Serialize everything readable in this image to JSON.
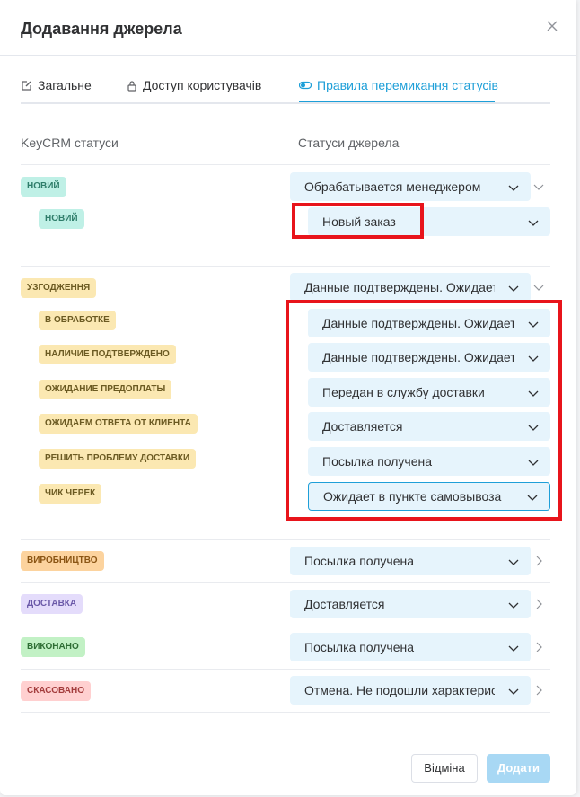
{
  "modal": {
    "title": "Додавання джерела"
  },
  "tabs": [
    {
      "label": "Загальне",
      "icon": "edit-icon"
    },
    {
      "label": "Доступ користувачів",
      "icon": "lock-icon"
    },
    {
      "label": "Правила перемикання статусів",
      "icon": "toggle-icon",
      "active": true
    }
  ],
  "columns": {
    "left": "KeyCRM статуси",
    "right": "Статуси джерела"
  },
  "groups": [
    {
      "status": "НОВИЙ",
      "color": "teal",
      "source": "Обрабатывается менеджером",
      "expanded": true,
      "children": [
        {
          "status": "НОВИЙ",
          "source": "Новый заказ"
        }
      ]
    },
    {
      "status": "УЗГОДЖЕННЯ",
      "color": "yellow",
      "source": "Данные подтверждены. Ожидает отп",
      "expanded": true,
      "children": [
        {
          "status": "В ОБРАБОТКЕ",
          "source": "Данные подтверждены. Ожидает отп"
        },
        {
          "status": "НАЛИЧИЕ ПОДТВЕРЖДЕНО",
          "source": "Данные подтверждены. Ожидает отп"
        },
        {
          "status": "ОЖИДАНИЕ ПРЕДОПЛАТЫ",
          "source": "Передан в службу доставки"
        },
        {
          "status": "ОЖИДАЕМ ОТВЕТА ОТ КЛИЕНТА",
          "source": "Доставляется"
        },
        {
          "status": "РЕШИТЬ ПРОБЛЕМУ ДОСТАВКИ",
          "source": "Посылка получена"
        },
        {
          "status": "ЧИК ЧЕРЕК",
          "source": "Ожидает в пункте самовывоза",
          "focused": true
        }
      ]
    },
    {
      "status": "ВИРОБНИЦТВО",
      "color": "orange",
      "source": "Посылка получена",
      "expanded": false
    },
    {
      "status": "ДОСТАВКА",
      "color": "purple",
      "source": "Доставляется",
      "expanded": false
    },
    {
      "status": "ВИКОНАНО",
      "color": "green",
      "source": "Посылка получена",
      "expanded": false
    },
    {
      "status": "СКАСОВАНО",
      "color": "red",
      "source": "Отмена. Не подошли характеристики",
      "expanded": false
    }
  ],
  "footer": {
    "cancel": "Відміна",
    "submit": "Додати"
  },
  "colors": {
    "accent": "#1e9fd8",
    "highlight": "#e8141b"
  }
}
